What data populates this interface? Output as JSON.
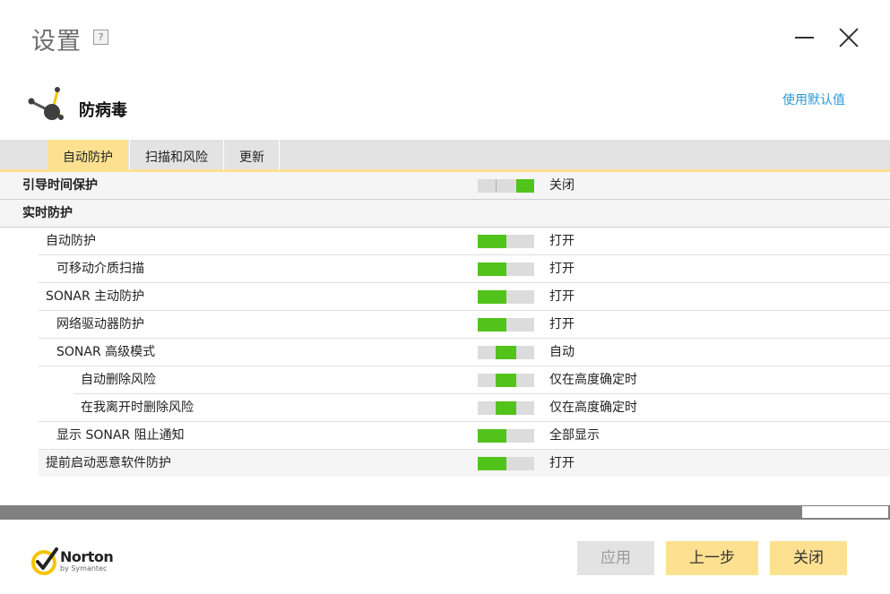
{
  "window": {
    "title": "设置",
    "help": "?"
  },
  "section": {
    "title": "防病毒",
    "defaults_link": "使用默认值"
  },
  "tabs": [
    {
      "label": "自动防护"
    },
    {
      "label": "扫描和风险"
    },
    {
      "label": "更新"
    }
  ],
  "settings": [
    {
      "label": "引导时间保护",
      "state": "关闭",
      "switch": "off"
    },
    {
      "label": "实时防护"
    },
    {
      "label": "自动防护",
      "state": "打开",
      "switch": "on"
    },
    {
      "label": "可移动介质扫描",
      "state": "打开",
      "switch": "on"
    },
    {
      "label": "SONAR 主动防护",
      "state": "打开",
      "switch": "on"
    },
    {
      "label": "网络驱动器防护",
      "state": "打开",
      "switch": "on"
    },
    {
      "label": "SONAR 高级模式",
      "state": "自动",
      "switch": "auto"
    },
    {
      "label": "自动删除风险",
      "state": "仅在高度确定时",
      "switch": "auto"
    },
    {
      "label": "在我离开时删除风险",
      "state": "仅在高度确定时",
      "switch": "auto"
    },
    {
      "label": "显示 SONAR 阻止通知",
      "state": "全部显示",
      "switch": "on"
    },
    {
      "label": "提前启动恶意软件防护",
      "state": "打开",
      "switch": "on"
    }
  ],
  "footer": {
    "brand": "Norton",
    "brand_sub": "by Symantec",
    "apply": "应用",
    "back": "上一步",
    "close": "关闭"
  },
  "colors": {
    "accent": "#fee190",
    "switch_on": "#52c31b",
    "link": "#2a9bd8"
  }
}
